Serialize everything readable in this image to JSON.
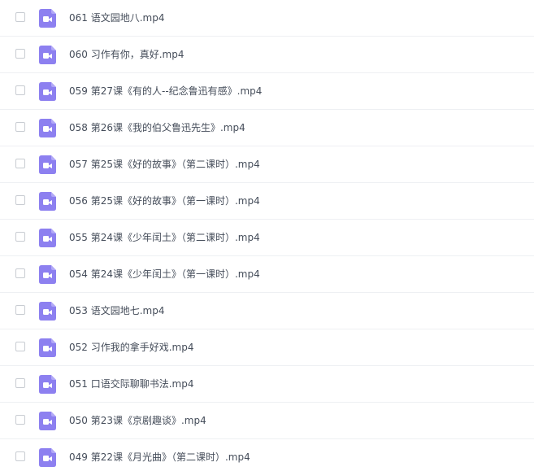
{
  "file_list": {
    "icon": "video-file-icon",
    "icon_color": "#8d80f0",
    "items": [
      {
        "name": "061 语文园地八.mp4"
      },
      {
        "name": "060 习作有你，真好.mp4"
      },
      {
        "name": "059 第27课《有的人--纪念鲁迅有感》.mp4"
      },
      {
        "name": "058 第26课《我的伯父鲁迅先生》.mp4"
      },
      {
        "name": "057 第25课《好的故事》（第二课时）.mp4"
      },
      {
        "name": "056 第25课《好的故事》（第一课时）.mp4"
      },
      {
        "name": "055 第24课《少年闰土》（第二课时）.mp4"
      },
      {
        "name": "054 第24课《少年闰土》（第一课时）.mp4"
      },
      {
        "name": "053 语文园地七.mp4"
      },
      {
        "name": "052 习作我的拿手好戏.mp4"
      },
      {
        "name": "051 口语交际聊聊书法.mp4"
      },
      {
        "name": "050 第23课《京剧趣谈》.mp4"
      },
      {
        "name": "049 第22课《月光曲》（第二课时）.mp4"
      }
    ]
  }
}
